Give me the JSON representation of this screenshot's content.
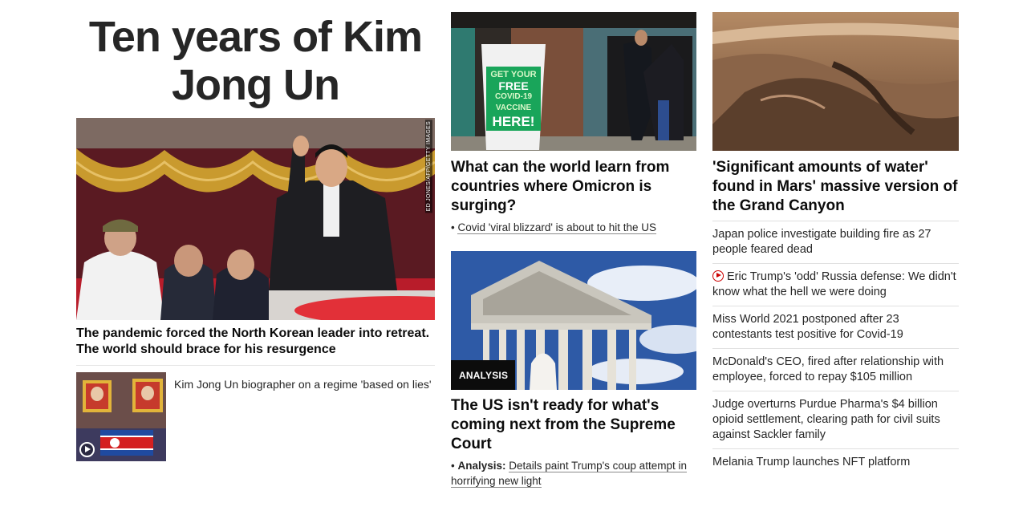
{
  "zone": {
    "title": "Ten years of Kim Jong Un"
  },
  "column1": {
    "hero": {
      "image_credit": "ED JONES/AFP/GETTY IMAGES",
      "headline": "The pandemic forced the North Korean leader into retreat. The world should brace for his resurgence"
    },
    "secondary": {
      "headline": "Kim Jong Un biographer on a regime 'based on lies'",
      "has_video": true
    }
  },
  "column2": {
    "story1": {
      "sign_text": [
        "GET YOUR",
        "FREE",
        "COVID-19",
        "VACCINE",
        "HERE!"
      ],
      "headline": "What can the world learn from countries where Omicron is surging?",
      "bullet": "Covid 'viral blizzard' is about to hit the US"
    },
    "story2": {
      "badge": "ANALYSIS",
      "headline": "The US isn't ready for what's coming next from the Supreme Court",
      "bullet_prefix": "Analysis:",
      "bullet": "Details paint Trump's coup attempt in horrifying new light"
    }
  },
  "column3": {
    "lead_headline": "'Significant amounts of water' found in Mars' massive version of the Grand Canyon",
    "list": [
      {
        "text": "Japan police investigate building fire as 27 people feared dead",
        "video": false
      },
      {
        "text": "Eric Trump's 'odd' Russia defense: We didn't know what the hell we were doing",
        "video": true
      },
      {
        "text": "Miss World 2021 postponed after 23 contestants test positive for Covid-19",
        "video": false
      },
      {
        "text": "McDonald's CEO, fired after relationship with employee, forced to repay $105 million",
        "video": false
      },
      {
        "text": "Judge overturns Purdue Pharma's $4 billion opioid settlement, clearing path for civil suits against Sackler family",
        "video": false
      },
      {
        "text": "Melania Trump launches NFT platform",
        "video": false
      }
    ]
  },
  "colors": {
    "video_accent": "#cc0000",
    "text": "#0c0c0c",
    "divider": "#e0e0e0"
  }
}
